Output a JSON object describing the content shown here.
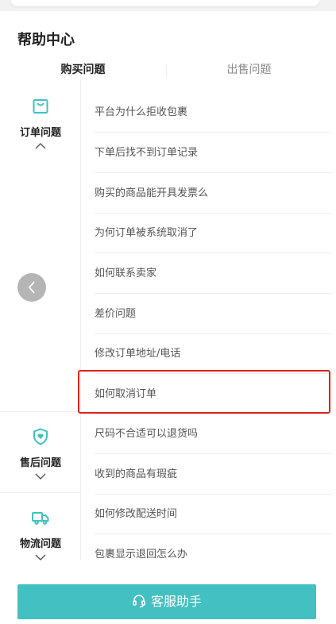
{
  "page": {
    "title": "帮助中心"
  },
  "tabs": [
    {
      "label": "购买问题",
      "active": true
    },
    {
      "label": "出售问题",
      "active": false
    }
  ],
  "categories": [
    {
      "label": "订单问题",
      "icon": "shopping-bag-icon",
      "expanded": true
    },
    {
      "label": "售后问题",
      "icon": "shield-heart-icon",
      "expanded": false
    },
    {
      "label": "物流问题",
      "icon": "truck-icon",
      "expanded": false
    }
  ],
  "questions": [
    {
      "text": "平台为什么拒收包裹",
      "category": "订单问题"
    },
    {
      "text": "下单后找不到订单记录",
      "category": "订单问题"
    },
    {
      "text": "购买的商品能开具发票么",
      "category": "订单问题"
    },
    {
      "text": "为何订单被系统取消了",
      "category": "订单问题"
    },
    {
      "text": "如何联系卖家",
      "category": "订单问题"
    },
    {
      "text": "差价问题",
      "category": "订单问题"
    },
    {
      "text": "修改订单地址/电话",
      "category": "订单问题"
    },
    {
      "text": "如何取消订单",
      "category": "订单问题",
      "highlighted": true
    },
    {
      "text": "尺码不合适可以退货吗",
      "category": "售后问题"
    },
    {
      "text": "收到的商品有瑕疵",
      "category": "售后问题"
    },
    {
      "text": "如何修改配送时间",
      "category": "物流问题"
    },
    {
      "text": "包裹显示退回怎么办",
      "category": "物流问题"
    }
  ],
  "footer": {
    "button_label": "客服助手",
    "icon": "headset-icon"
  },
  "colors": {
    "accent": "#42c0c2",
    "highlight": "#e02020"
  }
}
